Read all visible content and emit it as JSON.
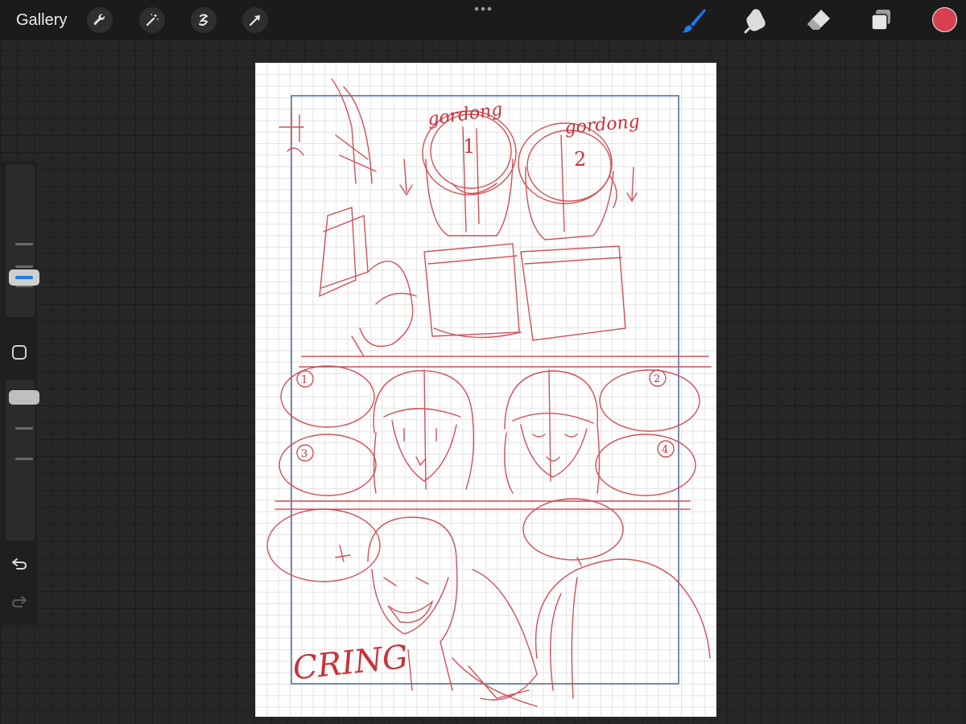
{
  "topbar": {
    "gallery_label": "Gallery",
    "left_tools": [
      "wrench-icon",
      "magic-wand-icon",
      "selection-icon",
      "transform-arrow-icon"
    ],
    "right_tools": [
      "brush-icon",
      "smudge-icon",
      "eraser-icon",
      "layers-icon"
    ],
    "active_tool": "brush-icon",
    "brush_color": "#1a7cf0",
    "current_color": "#d9404f"
  },
  "sidebar": {
    "brush_size_level": 0.7,
    "opacity_level": 0.6,
    "accent": "#1a7cf0"
  },
  "canvas": {
    "sketch_color": "#c8323a",
    "frame_color": "#3a5a8c",
    "labels": {
      "top_left": "gordong",
      "top_right": "gordong",
      "num1": "1",
      "num2": "2",
      "bubble1": "1",
      "bubble2": "2",
      "bubble3": "3",
      "bubble4": "4",
      "sfx": "CRING"
    }
  }
}
